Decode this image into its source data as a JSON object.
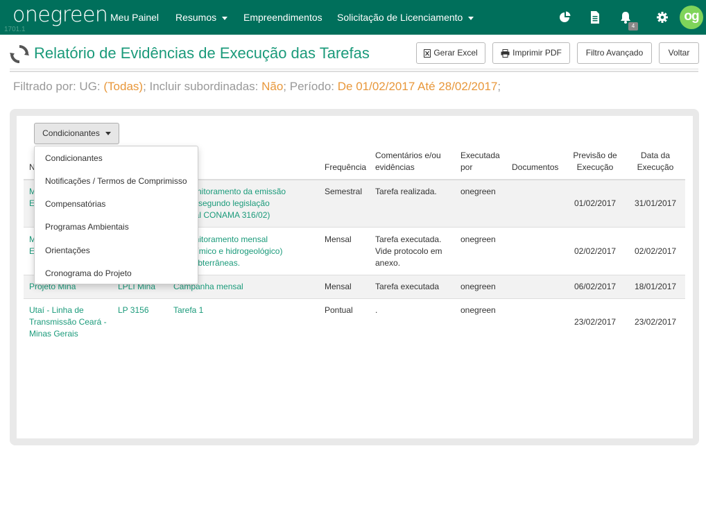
{
  "navbar": {
    "logo": "onegreen",
    "version": "1701.1",
    "items": [
      {
        "label": "Meu Painel"
      },
      {
        "label": "Resumos"
      },
      {
        "label": "Empreendimentos"
      },
      {
        "label": "Solicitação de Licenciamento"
      }
    ],
    "icons": [
      "pie-chart-icon",
      "document-icon",
      "bell-icon",
      "gear-icon"
    ],
    "notification_count": "4",
    "avatar": "og",
    "colors": {
      "bar": "#006f5b",
      "avatar": "#7fd45a"
    }
  },
  "page": {
    "title": "Relatório de Evidências de Execução das Tarefas",
    "buttons": {
      "excel": "Gerar Excel",
      "pdf": "Imprimir PDF",
      "filter": "Filtro Avançado",
      "back": "Voltar"
    }
  },
  "filter": {
    "prefix": "Filtrado por: UG: ",
    "ug": "(Todas)",
    "sub_label": "; Incluir subordinadas: ",
    "sub_value": "Não",
    "period_label": "; Período: ",
    "period_value": "De 01/02/2017 Até 28/02/2017",
    "end": ";"
  },
  "dropdown": {
    "button": "Condicionantes",
    "items": [
      "Condicionantes",
      "Notificações / Termos de Comprimisso",
      "Compensatórias",
      "Programas Ambientais",
      "Orientações",
      "Cronograma do Projeto"
    ]
  },
  "table": {
    "headers": {
      "first": "N",
      "frequencia": "Frequência",
      "comentarios_1": "Comentários e/ou",
      "comentarios_2": "evidências",
      "executada_1": "Executada",
      "executada_2": "por",
      "documentos": "Documentos",
      "previsao_1": "Previsão de",
      "previsao_2": "Execução",
      "data_1": "Data da",
      "data_2": "Execução"
    },
    "rows": [
      {
        "emp_1": "M",
        "emp_2": "E",
        "tarefa_1": "r o monitoramento da emissão",
        "tarefa_2": "férica, segundo legislação",
        "tarefa_3": "e (atual CONAMA 316/02)",
        "frequencia": "Semestral",
        "comentario_1": "Tarefa realizada.",
        "comentario_2": "",
        "comentario_3": "",
        "executada_por": "onegreen",
        "previsao": "01/02/2017",
        "data": "31/01/2017"
      },
      {
        "emp_1": "M",
        "emp_2": "E",
        "tarefa_1": "ar monitoramento mensal",
        "tarefa_2": "geoquímico e hidrogeológico)",
        "tarefa_3": "uas subterrâneas.",
        "frequencia": "Mensal",
        "comentario_1": "Tarefa executada.",
        "comentario_2": "Vide protocolo em",
        "comentario_3": "anexo.",
        "executada_por": "onegreen",
        "previsao": "02/02/2017",
        "data": "02/02/2017"
      },
      {
        "emp_1": "Projeto Mina",
        "emp_2": "",
        "lic": "LPLI Mina",
        "tarefa_1": "Campanha mensal",
        "frequencia": "Mensal",
        "comentario_1": "Tarefa executada",
        "executada_por": "onegreen",
        "previsao": "06/02/2017",
        "data": "18/01/2017"
      },
      {
        "emp_1": "Utaí - Linha de",
        "emp_2": "Transmissão Ceará -",
        "emp_3": "Minas Gerais",
        "lic": "LP 3156",
        "tarefa_1": "Tarefa 1",
        "frequencia": "Pontual",
        "comentario_1": ".",
        "executada_por": "onegreen",
        "previsao": "23/02/2017",
        "data": "23/02/2017"
      }
    ]
  }
}
